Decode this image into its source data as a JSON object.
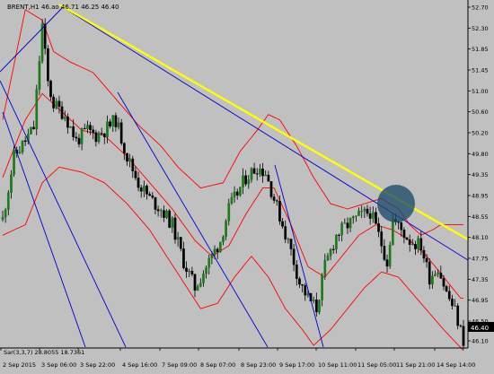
{
  "header": {
    "symbol_text": "BRENT,H1",
    "ohlc_text": "46.ao 46.71 46.25 46.40"
  },
  "indicator": {
    "label": "Sar(3,3,7) 28.8055 18.7361"
  },
  "colors": {
    "background": "#c0c0c0",
    "bull_candle": "#1f7a1f",
    "bear_candle": "#000000",
    "bollinger": "#ff0000",
    "channel_lines": "#0000cc",
    "trendline": "#ffff00",
    "price_marker": "#000000",
    "highlight_circle": "#1e4a6a"
  },
  "chart_data": {
    "type": "candlestick",
    "instrument": "BRENT",
    "timeframe": "H1",
    "ylim": [
      46.25,
      52.85
    ],
    "y_ticks": [
      "52.70",
      "52.30",
      "51.85",
      "51.45",
      "51.00",
      "50.60",
      "50.20",
      "49.80",
      "49.35",
      "48.95",
      "48.55",
      "48.10",
      "47.75",
      "47.35",
      "46.95",
      "46.50",
      "46.10"
    ],
    "x_ticks": [
      "2 Sep 2015",
      "3 Sep 06:00",
      "3 Sep 22:00",
      "4 Sep 16:00",
      "7 Sep 09:00",
      "8 Sep 07:00",
      "8 Sep 23:00",
      "9 Sep 17:00",
      "10 Sep 11:00",
      "11 Sep 05:00",
      "11 Sep 21:00",
      "14 Sep 14:00"
    ],
    "last_price": "46.40",
    "close_path": [
      [
        0,
        48.7
      ],
      [
        4,
        49.9
      ],
      [
        8,
        50.2
      ],
      [
        11,
        50.45
      ],
      [
        14,
        52.4
      ],
      [
        16,
        51.3
      ],
      [
        18,
        50.9
      ],
      [
        22,
        50.7
      ],
      [
        26,
        50.2
      ],
      [
        30,
        50.4
      ],
      [
        33,
        50.3
      ],
      [
        36,
        50.4
      ],
      [
        40,
        50.6
      ],
      [
        44,
        49.9
      ],
      [
        48,
        49.4
      ],
      [
        52,
        49.1
      ],
      [
        56,
        48.9
      ],
      [
        60,
        48.6
      ],
      [
        64,
        47.9
      ],
      [
        68,
        47.4
      ],
      [
        70,
        47.6
      ],
      [
        73,
        47.9
      ],
      [
        77,
        48.3
      ],
      [
        80,
        48.9
      ],
      [
        83,
        49.2
      ],
      [
        86,
        49.5
      ],
      [
        90,
        49.7
      ],
      [
        93,
        49.6
      ],
      [
        96,
        49.1
      ],
      [
        99,
        48.6
      ],
      [
        102,
        48.1
      ],
      [
        105,
        47.5
      ],
      [
        108,
        47.2
      ],
      [
        111,
        47.0
      ],
      [
        114,
        47.8
      ],
      [
        118,
        48.4
      ],
      [
        122,
        48.6
      ],
      [
        126,
        48.75
      ],
      [
        130,
        48.85
      ],
      [
        133,
        48.4
      ],
      [
        136,
        47.9
      ],
      [
        138,
        48.7
      ],
      [
        141,
        48.5
      ],
      [
        144,
        48.3
      ],
      [
        148,
        48.2
      ],
      [
        151,
        47.6
      ],
      [
        154,
        47.8
      ],
      [
        157,
        47.3
      ],
      [
        160,
        46.95
      ],
      [
        163,
        46.4
      ]
    ],
    "bollinger_upper": [
      [
        0,
        50.6
      ],
      [
        8,
        52.7
      ],
      [
        14,
        52.5
      ],
      [
        18,
        51.9
      ],
      [
        24,
        51.7
      ],
      [
        32,
        51.5
      ],
      [
        40,
        51.0
      ],
      [
        48,
        50.5
      ],
      [
        56,
        50.1
      ],
      [
        62,
        49.7
      ],
      [
        70,
        49.3
      ],
      [
        78,
        49.4
      ],
      [
        84,
        50.0
      ],
      [
        90,
        50.4
      ],
      [
        94,
        50.7
      ],
      [
        98,
        50.6
      ],
      [
        104,
        50.1
      ],
      [
        110,
        49.5
      ],
      [
        116,
        49.0
      ],
      [
        122,
        48.9
      ],
      [
        128,
        49.0
      ],
      [
        134,
        49.1
      ],
      [
        140,
        48.9
      ],
      [
        144,
        48.6
      ],
      [
        148,
        48.4
      ],
      [
        152,
        48.5
      ],
      [
        155,
        48.6
      ]
    ],
    "bollinger_middle": [
      [
        0,
        49.5
      ],
      [
        8,
        50.6
      ],
      [
        14,
        51.1
      ],
      [
        20,
        50.8
      ],
      [
        28,
        50.4
      ],
      [
        36,
        50.3
      ],
      [
        44,
        49.9
      ],
      [
        52,
        49.4
      ],
      [
        60,
        48.9
      ],
      [
        68,
        48.3
      ],
      [
        74,
        48.0
      ],
      [
        80,
        48.2
      ],
      [
        86,
        48.8
      ],
      [
        92,
        49.3
      ],
      [
        96,
        49.3
      ],
      [
        102,
        48.6
      ],
      [
        108,
        47.8
      ],
      [
        114,
        47.6
      ],
      [
        120,
        48.0
      ],
      [
        126,
        48.4
      ],
      [
        132,
        48.6
      ],
      [
        138,
        48.5
      ],
      [
        144,
        48.3
      ],
      [
        150,
        48.0
      ],
      [
        156,
        47.6
      ],
      [
        162,
        47.2
      ]
    ],
    "bollinger_lower": [
      [
        0,
        48.4
      ],
      [
        8,
        48.6
      ],
      [
        14,
        49.4
      ],
      [
        20,
        49.7
      ],
      [
        28,
        49.6
      ],
      [
        36,
        49.4
      ],
      [
        44,
        49.0
      ],
      [
        52,
        48.5
      ],
      [
        58,
        48.0
      ],
      [
        64,
        47.5
      ],
      [
        70,
        47.0
      ],
      [
        76,
        47.1
      ],
      [
        82,
        47.6
      ],
      [
        88,
        48.0
      ],
      [
        94,
        47.6
      ],
      [
        100,
        47.0
      ],
      [
        106,
        46.6
      ],
      [
        110,
        46.3
      ],
      [
        116,
        46.6
      ],
      [
        122,
        47.0
      ],
      [
        128,
        47.4
      ],
      [
        134,
        47.7
      ],
      [
        140,
        47.6
      ],
      [
        148,
        47.1
      ],
      [
        156,
        46.6
      ],
      [
        163,
        46.2
      ]
    ]
  }
}
